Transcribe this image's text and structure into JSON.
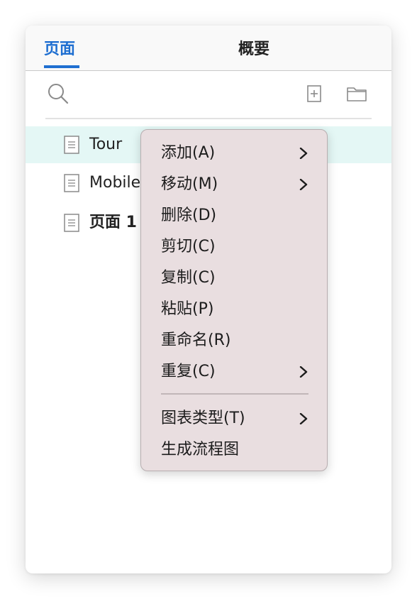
{
  "tabs": [
    {
      "label": "页面"
    },
    {
      "label": "概要"
    }
  ],
  "toolbar": {
    "search_icon": "search-icon",
    "add_page_icon": "add-page-icon",
    "folder_icon": "folder-icon"
  },
  "pages": [
    {
      "label": "Tour",
      "selected": true
    },
    {
      "label": "Mobile",
      "selected": false
    },
    {
      "label": "页面 1",
      "selected": false
    }
  ],
  "context_menu": {
    "items": [
      {
        "label": "添加(A)",
        "submenu": true
      },
      {
        "label": "移动(M)",
        "submenu": true
      },
      {
        "label": "删除(D)",
        "submenu": false
      },
      {
        "label": "剪切(C)",
        "submenu": false
      },
      {
        "label": "复制(C)",
        "submenu": false
      },
      {
        "label": "粘贴(P)",
        "submenu": false
      },
      {
        "label": "重命名(R)",
        "submenu": false
      },
      {
        "label": "重复(C)",
        "submenu": true
      },
      {
        "label": "图表类型(T)",
        "submenu": true
      },
      {
        "label": "生成流程图",
        "submenu": false
      }
    ]
  },
  "colors": {
    "accent": "#1f6fd1",
    "selected_row": "#e4f7f5",
    "menu_background": "#e9dee0"
  }
}
